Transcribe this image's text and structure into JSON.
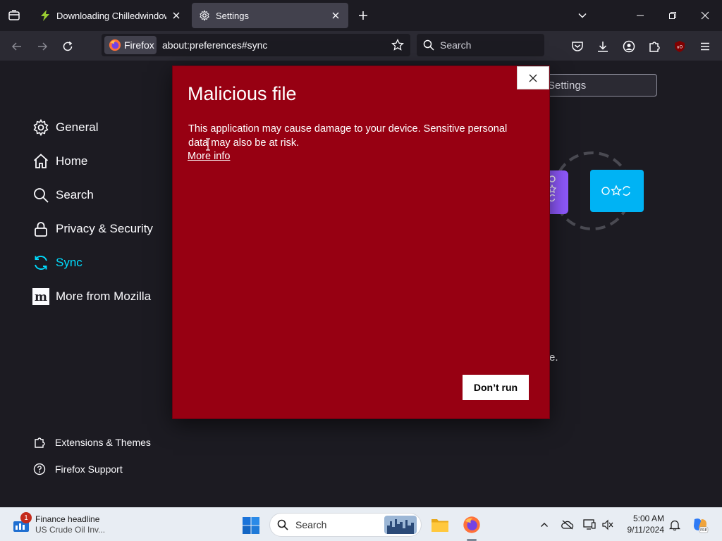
{
  "tabs": [
    {
      "title": "Downloading Chilledwindows.e",
      "icon": "bolt-icon"
    },
    {
      "title": "Settings",
      "icon": "gear-icon"
    }
  ],
  "navbar": {
    "identity_label": "Firefox",
    "url": "about:preferences#sync",
    "search_placeholder": "Search"
  },
  "settings": {
    "categories": [
      {
        "label": "General",
        "icon": "gear-icon"
      },
      {
        "label": "Home",
        "icon": "home-icon"
      },
      {
        "label": "Search",
        "icon": "search-icon"
      },
      {
        "label": "Privacy & Security",
        "icon": "lock-icon"
      },
      {
        "label": "Sync",
        "icon": "sync-icon"
      },
      {
        "label": "More from Mozilla",
        "icon": "mozilla-icon"
      }
    ],
    "active_category": "Sync",
    "find_placeholder": "Settings",
    "hidden_text_tail": "e.",
    "footer": [
      {
        "label": "Extensions & Themes",
        "icon": "puzzle-icon"
      },
      {
        "label": "Firefox Support",
        "icon": "help-icon"
      }
    ]
  },
  "dialog": {
    "title": "Malicious file",
    "message": "This application may cause damage to your device. Sensitive personal data may also be at risk.",
    "link": "More info",
    "button": "Don’t run",
    "background": "#970012"
  },
  "taskbar": {
    "widget_title": "Finance headline",
    "widget_subtitle": "US Crude Oil Inv...",
    "widget_badge": "1",
    "search_placeholder": "Search",
    "time": "5:00 AM",
    "date": "9/11/2024"
  },
  "colors": {
    "accent": "#00ddff",
    "tab_active": "#42414d",
    "page_bg": "#1c1b22"
  }
}
